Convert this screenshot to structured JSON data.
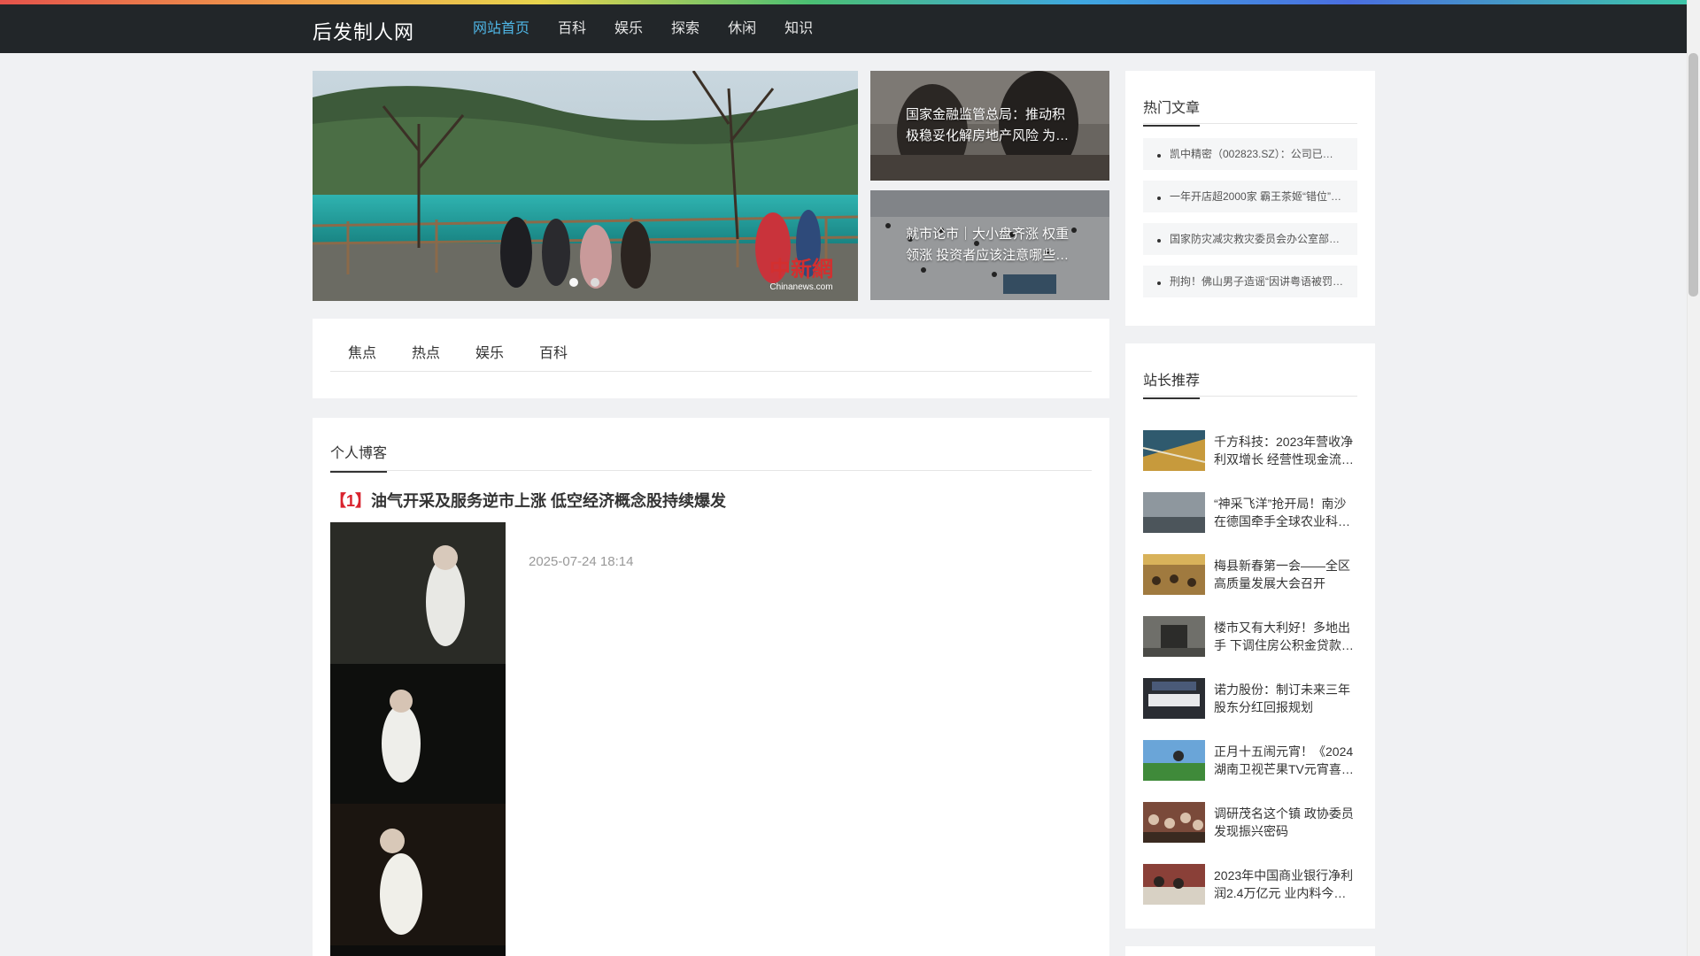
{
  "site": {
    "name": "后发制人网"
  },
  "nav": [
    "网站首页",
    "百科",
    "娱乐",
    "探索",
    "休闲",
    "知识"
  ],
  "slider": {
    "watermark": "中新網",
    "watermark_sub": "Chinanews.com"
  },
  "side_news": [
    {
      "title": "国家金融监管总局：推动积极稳妥化解房地产风险 为…"
    },
    {
      "title": "就市论市｜大小盘齐涨 权重领涨 投资者应该注意哪些…"
    }
  ],
  "tabs": [
    "焦点",
    "热点",
    "娱乐",
    "百科"
  ],
  "blog": {
    "heading": "个人博客",
    "article": {
      "num": "【1】",
      "title": "油气开采及服务逆市上涨 低空经济概念股持续爆发",
      "date": "2025-07-24 18:14"
    }
  },
  "hot": {
    "heading": "热门文章",
    "items": [
      "凯中精密（002823.SZ）：公司已…",
      "一年开店超2000家 霸王茶姬“错位”…",
      "国家防灾减灾救灾委员会办公室部…",
      "刑拘！佛山男子造谣“因讲粤语被罚…"
    ]
  },
  "recommend": {
    "heading": "站长推荐",
    "items": [
      "千方科技：2023年营收净利双增长 经营性现金流…",
      "“神采飞洋”抢开局！南沙在德国牵手全球农业科…",
      "梅县新春第一会——全区高质量发展大会召开",
      "楼市又有大利好！多地出手 下调住房公积金贷款…",
      "诺力股份：制订未来三年股东分红回报规划",
      "正月十五闹元宵！《2024湖南卫视芒果TV元宵喜…",
      "调研茂名这个镇 政协委员发现振兴密码",
      "2023年中国商业银行净利润2.4万亿元 业内料今…"
    ]
  }
}
